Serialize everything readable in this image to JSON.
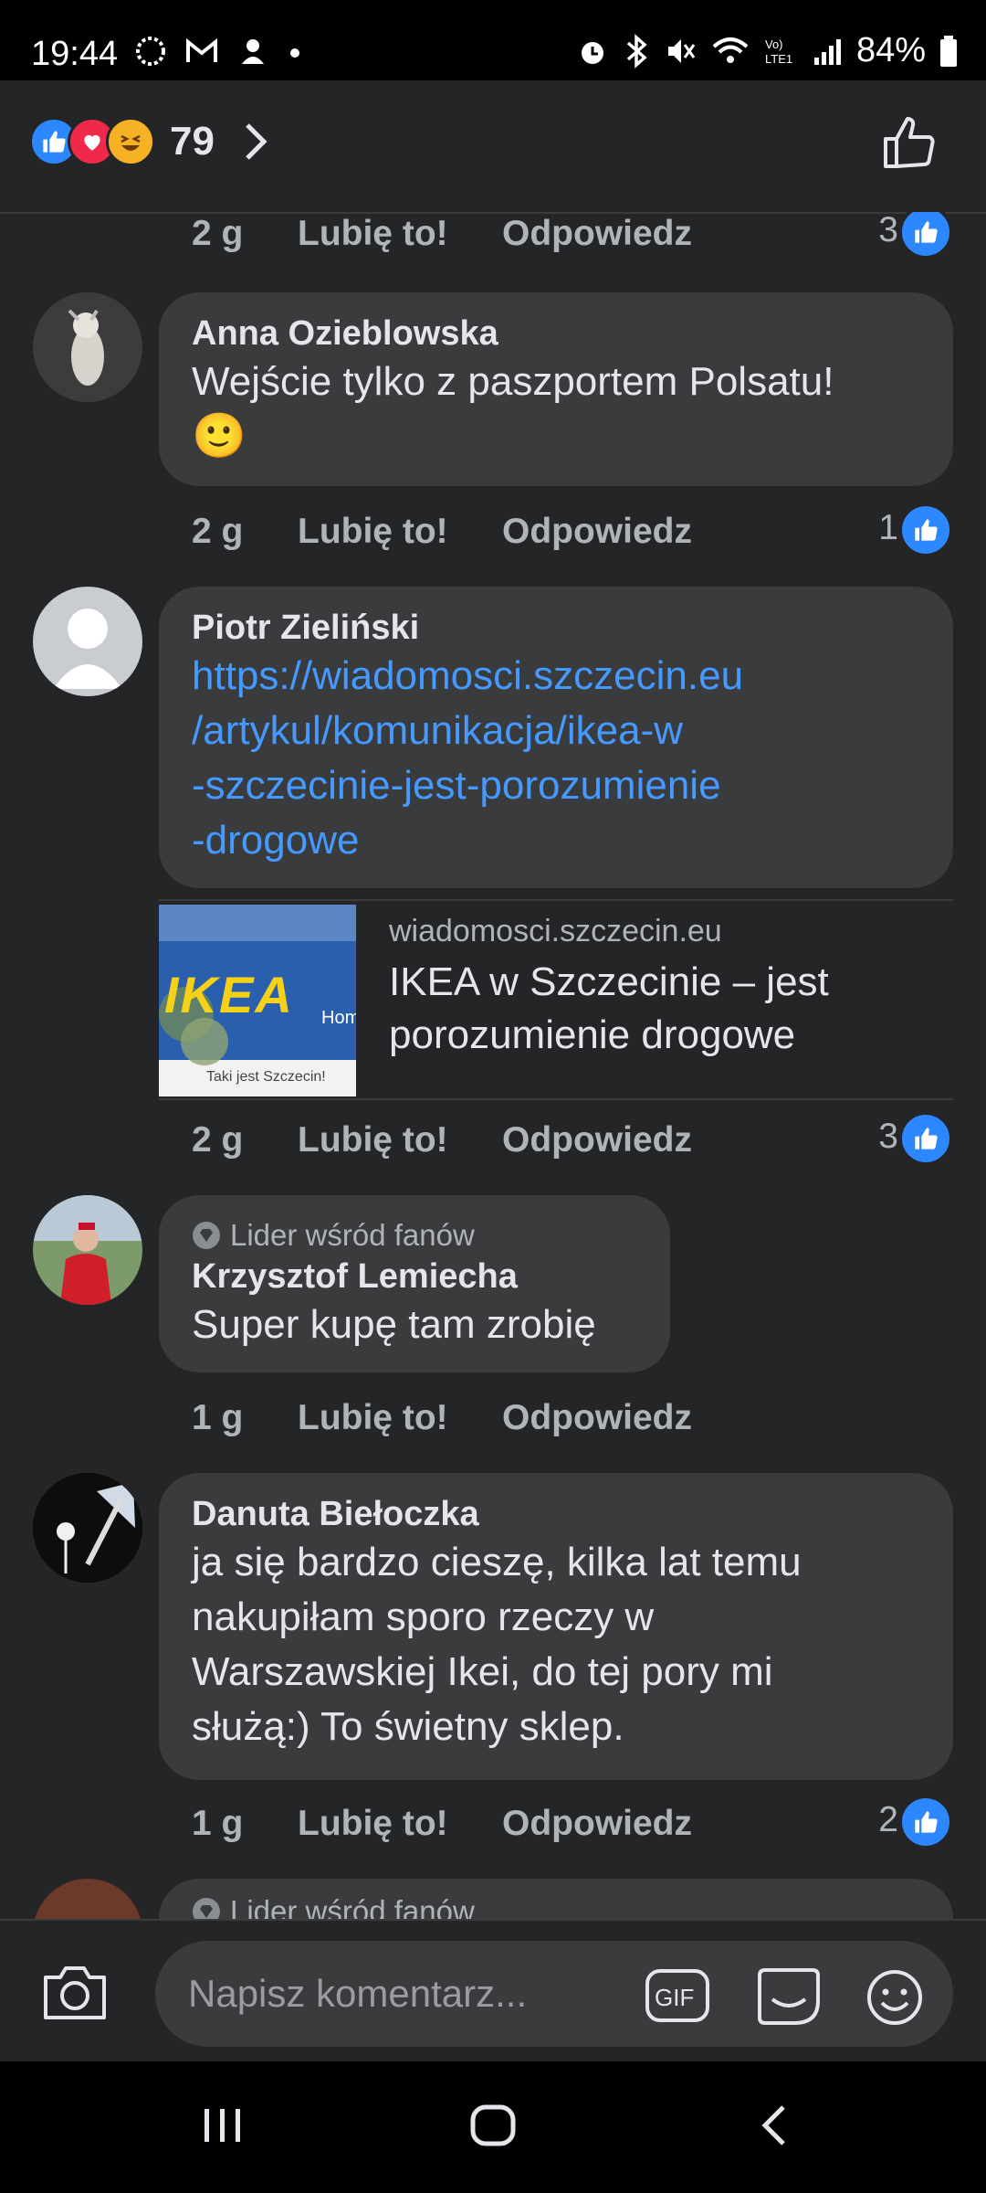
{
  "status_bar": {
    "time": "19:44",
    "battery": "84%"
  },
  "reactions_bar": {
    "count": "79"
  },
  "prev_comment": {
    "time": "2 g",
    "like_label": "Lubię to!",
    "reply_label": "Odpowiedz",
    "like_count": "3"
  },
  "comments": [
    {
      "author": "Anna Ozieblowska",
      "text": "Wejście tylko z paszportem Polsatu!",
      "emoji": "🙂",
      "time": "2 g",
      "like_label": "Lubię to!",
      "reply_label": "Odpowiedz",
      "like_count": "1"
    },
    {
      "author": "Piotr Zieliński",
      "link": "https://wiadomosci.szczecin.eu/artykul/komunikacja/ikea-w-szczecinie-jest-porozumienie-drogowe",
      "link_lines": [
        "https://wiadomosci.szczecin.eu",
        "/artykul/komunikacja/ikea-w",
        "-szczecinie-jest-porozumienie",
        "-drogowe"
      ],
      "preview_domain": "wiadomosci.szczecin.eu",
      "preview_title": "IKEA w Szczecinie – jest porozumienie drogowe",
      "preview_thumb_text": "IKEA",
      "preview_thumb_caption": "Taki jest Szczecin!",
      "time": "2 g",
      "like_label": "Lubię to!",
      "reply_label": "Odpowiedz",
      "like_count": "3"
    },
    {
      "badge": "Lider wśród fanów",
      "author": "Krzysztof Lemiecha",
      "text": "Super kupę tam zrobię",
      "time": "1 g",
      "like_label": "Lubię to!",
      "reply_label": "Odpowiedz"
    },
    {
      "author": "Danuta Biełoczka",
      "text_lines": [
        "ja się bardzo cieszę, kilka lat temu",
        "nakupiłam sporo rzeczy w",
        "Warszawskiej Ikei, do tej pory mi",
        "służą:) To świetny sklep."
      ],
      "time": "1 g",
      "like_label": "Lubię to!",
      "reply_label": "Odpowiedz",
      "like_count": "2"
    },
    {
      "badge": "Lider wśród fanów"
    }
  ],
  "composer": {
    "placeholder": "Napisz komentarz..."
  },
  "icons": [
    "camera-icon",
    "gif-icon",
    "sticker-icon",
    "emoji-icon",
    "like-icon",
    "chevron-right-icon"
  ],
  "colors": {
    "background": "#242526",
    "bubble": "#3a3b3c",
    "link": "#4599ff",
    "like_blue": "#2d88ff"
  }
}
